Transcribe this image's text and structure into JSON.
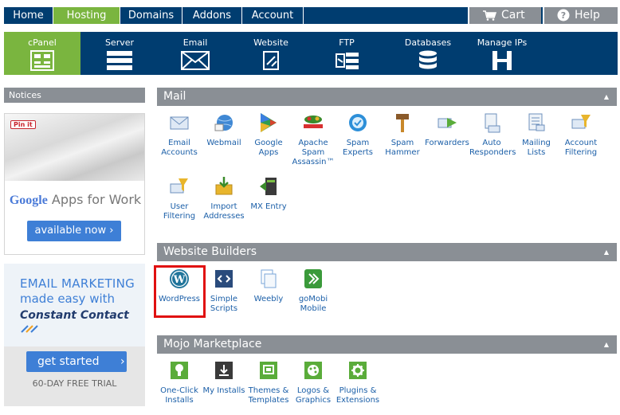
{
  "topnav": {
    "tabs": [
      {
        "label": "Home"
      },
      {
        "label": "Hosting"
      },
      {
        "label": "Domains"
      },
      {
        "label": "Addons"
      },
      {
        "label": "Account"
      }
    ],
    "cart_label": "Cart",
    "help_label": "Help"
  },
  "toolbar": {
    "items": [
      {
        "label": "cPanel",
        "icon": "cpanel-icon"
      },
      {
        "label": "Server",
        "icon": "server-icon"
      },
      {
        "label": "Email",
        "icon": "envelope-icon"
      },
      {
        "label": "Website",
        "icon": "website-icon"
      },
      {
        "label": "FTP",
        "icon": "ftp-icon"
      },
      {
        "label": "Databases",
        "icon": "database-icon"
      },
      {
        "label": "Manage IPs",
        "icon": "ip-icon"
      }
    ]
  },
  "sidebar": {
    "notices_title": "Notices",
    "ad_google": {
      "pin_label": "Pin it",
      "brand": "Google",
      "tagline": "Apps for Work",
      "button": "available now"
    },
    "ad_constant_contact": {
      "line1": "EMAIL MARKETING",
      "line2": "made easy with",
      "brand": "Constant Contact",
      "button": "get started",
      "subtext": "60-DAY FREE TRIAL"
    }
  },
  "sections": {
    "mail": {
      "title": "Mail",
      "items": [
        {
          "label": "Email Accounts"
        },
        {
          "label": "Webmail"
        },
        {
          "label": "Google Apps"
        },
        {
          "label": "Apache Spam Assassin™"
        },
        {
          "label": "Spam Experts"
        },
        {
          "label": "Spam Hammer"
        },
        {
          "label": "Forwarders"
        },
        {
          "label": "Auto Responders"
        },
        {
          "label": "Mailing Lists"
        },
        {
          "label": "Account Filtering"
        },
        {
          "label": "User Filtering"
        },
        {
          "label": "Import Addresses"
        },
        {
          "label": "MX Entry"
        }
      ]
    },
    "website_builders": {
      "title": "Website Builders",
      "items": [
        {
          "label": "WordPress"
        },
        {
          "label": "Simple Scripts"
        },
        {
          "label": "Weebly"
        },
        {
          "label": "goMobi Mobile"
        }
      ]
    },
    "mojo": {
      "title": "Mojo Marketplace",
      "items": [
        {
          "label": "One-Click Installs"
        },
        {
          "label": "My Installs"
        },
        {
          "label": "Themes & Templates"
        },
        {
          "label": "Logos & Graphics"
        },
        {
          "label": "Plugins & Extensions"
        }
      ]
    }
  },
  "colors": {
    "nav_blue": "#003d70",
    "accent_green": "#7ab53f",
    "header_gray": "#8a8f95",
    "link_blue": "#1b5fa8",
    "highlight_red": "#e01010"
  }
}
